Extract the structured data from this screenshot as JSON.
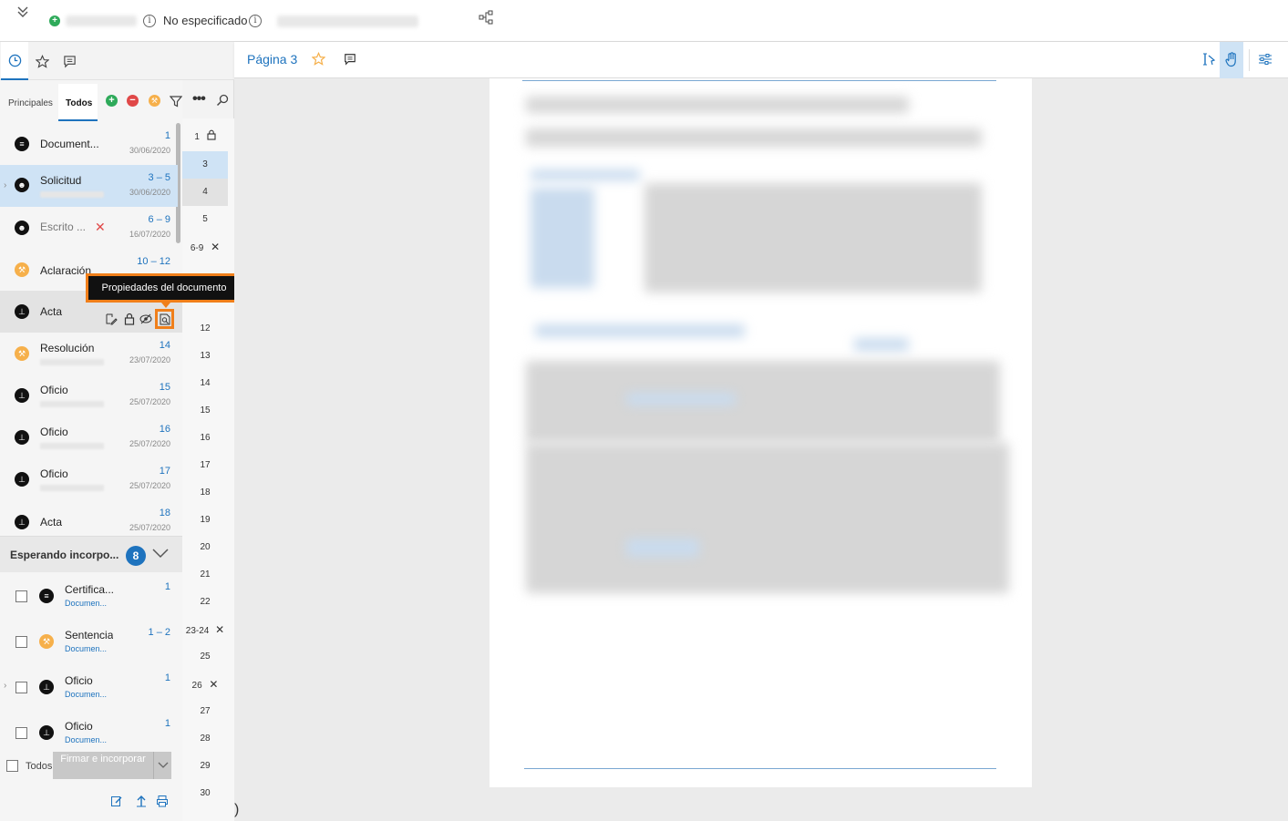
{
  "topbar": {
    "status_text": "No especificado",
    "collapse_icon": "double-chevron-down-icon",
    "status_icon": "green-plus-circle-icon",
    "info_icon": "info-icon",
    "network_icon": "hierarchy-icon"
  },
  "sidebar": {
    "tabs": [
      "history-icon",
      "star-icon",
      "comment-icon"
    ],
    "subtabs": [
      {
        "label": "Principales",
        "active": false
      },
      {
        "label": "Todos",
        "active": true
      }
    ]
  },
  "documents": [
    {
      "name": "Document...",
      "pages": "1",
      "date": "30/06/2020",
      "icon": "doc-icon",
      "color": "black"
    },
    {
      "name": "Solicitud",
      "pages": "3 – 5",
      "date": "30/06/2020",
      "icon": "people-icon",
      "color": "black"
    },
    {
      "name": "Escrito ...",
      "pages": "6 – 9",
      "date": "16/07/2020",
      "icon": "people-icon",
      "color": "black"
    },
    {
      "name": "Aclaración",
      "pages": "10 – 12",
      "date": "",
      "icon": "gavel-icon",
      "color": "orange"
    },
    {
      "name": "Acta",
      "pages": "",
      "date": "",
      "icon": "stamp-icon",
      "color": "black"
    },
    {
      "name": "Resolución",
      "pages": "14",
      "date": "23/07/2020",
      "icon": "gavel-icon",
      "color": "orange"
    },
    {
      "name": "Oficio",
      "pages": "15",
      "date": "25/07/2020",
      "icon": "stamp-icon",
      "color": "black"
    },
    {
      "name": "Oficio",
      "pages": "16",
      "date": "25/07/2020",
      "icon": "stamp-icon",
      "color": "black"
    },
    {
      "name": "Oficio",
      "pages": "17",
      "date": "25/07/2020",
      "icon": "stamp-icon",
      "color": "black"
    },
    {
      "name": "Acta",
      "pages": "18",
      "date": "25/07/2020",
      "icon": "stamp-icon",
      "color": "black"
    }
  ],
  "pending": {
    "title": "Esperando incorpo...",
    "count": "8",
    "items": [
      {
        "name": "Certifica...",
        "sub": "Documen...",
        "pages": "1",
        "color": "black"
      },
      {
        "name": "Sentencia",
        "sub": "Documen...",
        "pages": "1 – 2",
        "color": "orange"
      },
      {
        "name": "Oficio",
        "sub": "Documen...",
        "pages": "1",
        "color": "black"
      },
      {
        "name": "Oficio",
        "sub": "Documen...",
        "pages": "1",
        "color": "black"
      }
    ],
    "select_all": "Todos",
    "sign_button": "Firmar e incorporar"
  },
  "tooltip": "Propiedades del documento",
  "page_numbers": [
    "1",
    "3",
    "4",
    "5",
    "6-9",
    "",
    "12",
    "13",
    "14",
    "15",
    "16",
    "17",
    "18",
    "19",
    "20",
    "21",
    "22",
    "23-24",
    "25",
    "26",
    "27",
    "28",
    "29",
    "30"
  ],
  "viewer": {
    "page_title": "Página 3"
  },
  "colors": {
    "accent": "#1e73be",
    "highlight": "#f07f1a",
    "selected_row": "#cfe3f5",
    "orange_icon": "#f6b04b",
    "red": "#e04848",
    "green": "#2eaa5a"
  }
}
